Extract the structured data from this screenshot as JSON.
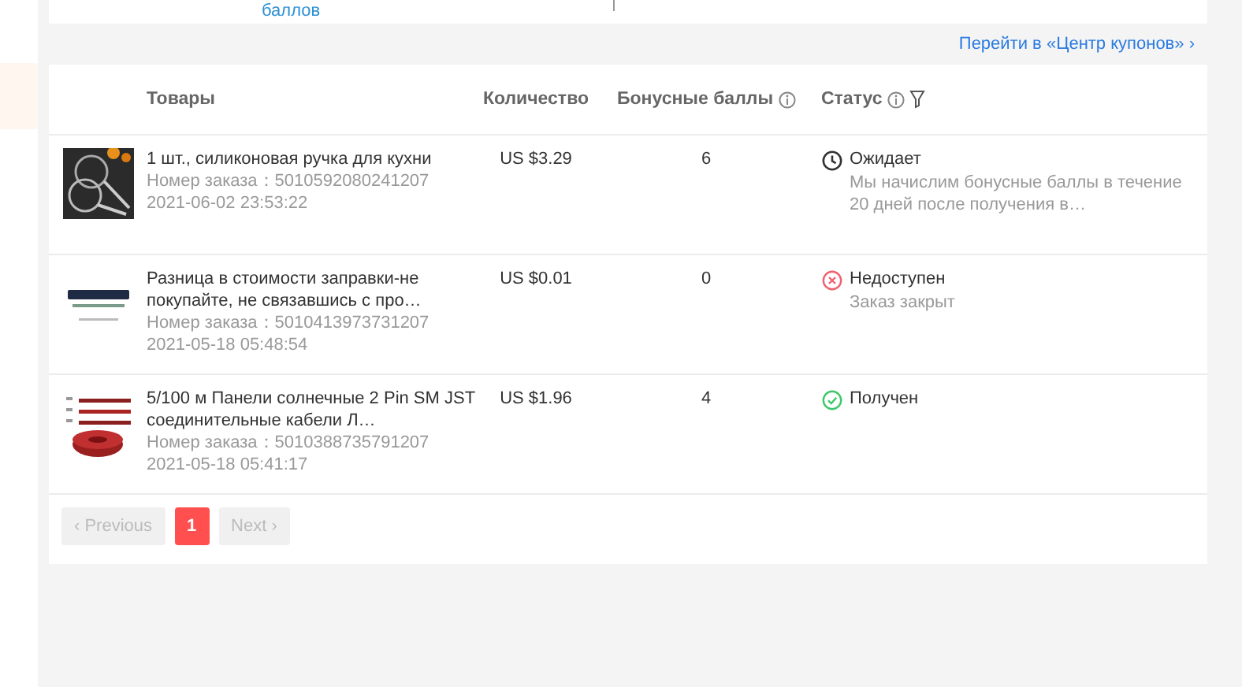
{
  "top_card": {
    "link": "баллов"
  },
  "coupon_link": "Перейти в «Центр купонов» ›",
  "table": {
    "columns": [
      {
        "label": "Товары"
      },
      {
        "label": "Количество"
      },
      {
        "label": "Бонусные баллы",
        "icons": [
          {
            "kind": "info"
          }
        ]
      },
      {
        "label": "Статус",
        "icons": [
          {
            "kind": "info"
          },
          {
            "kind": "filter"
          }
        ]
      }
    ],
    "rows": [
      {
        "title": "1 шт., силиконовая ручка для кухни",
        "order": "Номер заказа：5010592080241207",
        "date": "2021-06-02 23:53:22",
        "price": "US $3.29",
        "points": "6",
        "status": {
          "kind": "pending",
          "label": "Ожидает",
          "note": "Мы начислим бонусные баллы в течение 20 дней после получения в…"
        }
      },
      {
        "title": "Разница в стоимости заправки-не покупайте, не связавшись с про…",
        "order": "Номер заказа：5010413973731207",
        "date": "2021-05-18 05:48:54",
        "price": "US $0.01",
        "points": "0",
        "status": {
          "kind": "unavailable",
          "label": "Недоступен",
          "note": "Заказ закрыт"
        }
      },
      {
        "title": "5/100 м Панели солнечные 2 Pin SM JST соединительные кабели Л…",
        "order": "Номер заказа：5010388735791207",
        "date": "2021-05-18 05:41:17",
        "price": "US $1.96",
        "points": "4",
        "status": {
          "kind": "received",
          "label": "Получен"
        }
      }
    ]
  },
  "pagination": {
    "previous": {
      "label": "‹ Previous",
      "disabled": true
    },
    "pages": [
      {
        "label": "1",
        "selected": true
      }
    ],
    "next": {
      "label": "Next ›",
      "disabled": true
    }
  }
}
